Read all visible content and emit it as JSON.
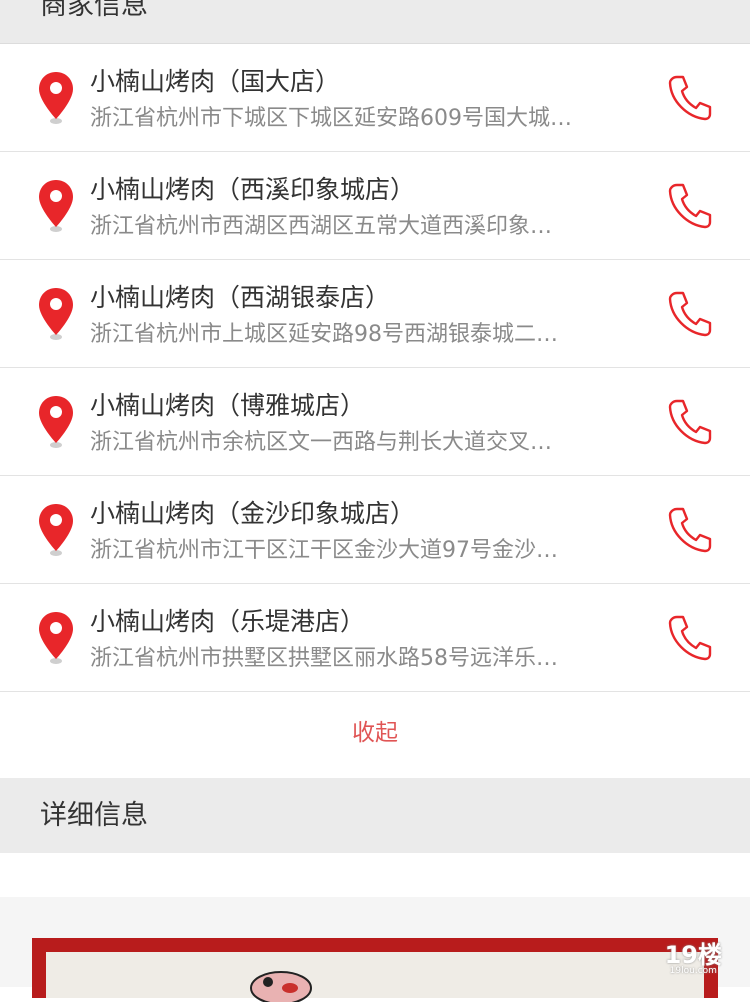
{
  "sections": {
    "merchant_info": "商家信息",
    "detail_info": "详细信息"
  },
  "stores": [
    {
      "name": "小楠山烤肉（国大店）",
      "address": "浙江省杭州市下城区下城区延安路609号国大城…"
    },
    {
      "name": "小楠山烤肉（西溪印象城店）",
      "address": "浙江省杭州市西湖区西湖区五常大道西溪印象…"
    },
    {
      "name": "小楠山烤肉（西湖银泰店）",
      "address": "浙江省杭州市上城区延安路98号西湖银泰城二…"
    },
    {
      "name": "小楠山烤肉（博雅城店）",
      "address": "浙江省杭州市余杭区文一西路与荆长大道交叉…"
    },
    {
      "name": "小楠山烤肉（金沙印象城店）",
      "address": "浙江省杭州市江干区江干区金沙大道97号金沙…"
    },
    {
      "name": "小楠山烤肉（乐堤港店）",
      "address": "浙江省杭州市拱墅区拱墅区丽水路58号远洋乐…"
    }
  ],
  "collapse_label": "收起",
  "watermark": {
    "main": "19楼",
    "sub": "19lou.com"
  },
  "icons": {
    "pin": "map-pin-icon",
    "phone": "phone-icon"
  },
  "colors": {
    "accent": "#e8262a",
    "section_bg": "#ebebeb",
    "collapse": "#e05555"
  }
}
